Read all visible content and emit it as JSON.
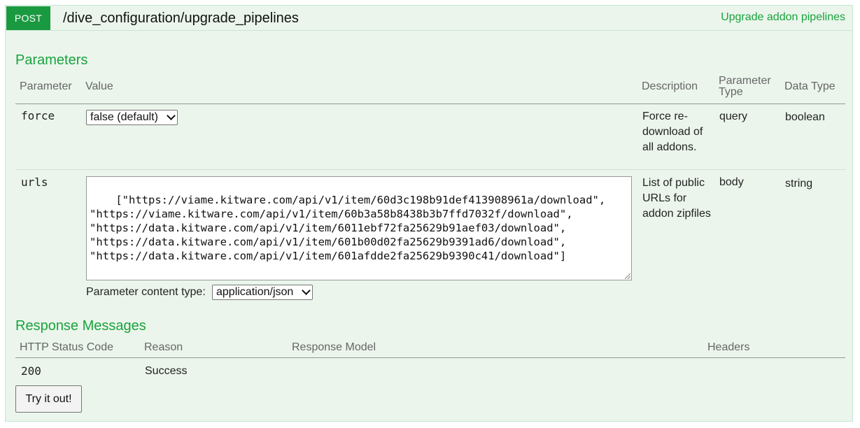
{
  "operation": {
    "method": "POST",
    "path": "/dive_configuration/upgrade_pipelines",
    "summary": "Upgrade addon pipelines"
  },
  "parameters": {
    "title": "Parameters",
    "headers": {
      "parameter": "Parameter",
      "value": "Value",
      "description": "Description",
      "parameter_type_line1": "Parameter",
      "parameter_type_line2": "Type",
      "data_type": "Data Type"
    },
    "rows": [
      {
        "name": "force",
        "value": "false (default)",
        "description": "Force re-download of all addons.",
        "param_type": "query",
        "data_type": "boolean"
      },
      {
        "name": "urls",
        "value": "[\"https://viame.kitware.com/api/v1/item/60d3c198b91def413908961a/download\",\n\"https://viame.kitware.com/api/v1/item/60b3a58b8438b3b7ffd7032f/download\",\n\"https://data.kitware.com/api/v1/item/6011ebf72fa25629b91aef03/download\",\n\"https://data.kitware.com/api/v1/item/601b00d02fa25629b9391ad6/download\",\n\"https://data.kitware.com/api/v1/item/601afdde2fa25629b9390c41/download\"]",
        "content_type_label": "Parameter content type:",
        "content_type": "application/json",
        "description": "List of public URLs for addon zipfiles",
        "param_type": "body",
        "data_type": "string"
      }
    ]
  },
  "responses": {
    "title": "Response Messages",
    "headers": {
      "status": "HTTP Status Code",
      "reason": "Reason",
      "model": "Response Model",
      "headers": "Headers"
    },
    "rows": [
      {
        "status": "200",
        "reason": "Success"
      }
    ]
  },
  "try_button": "Try it out!"
}
